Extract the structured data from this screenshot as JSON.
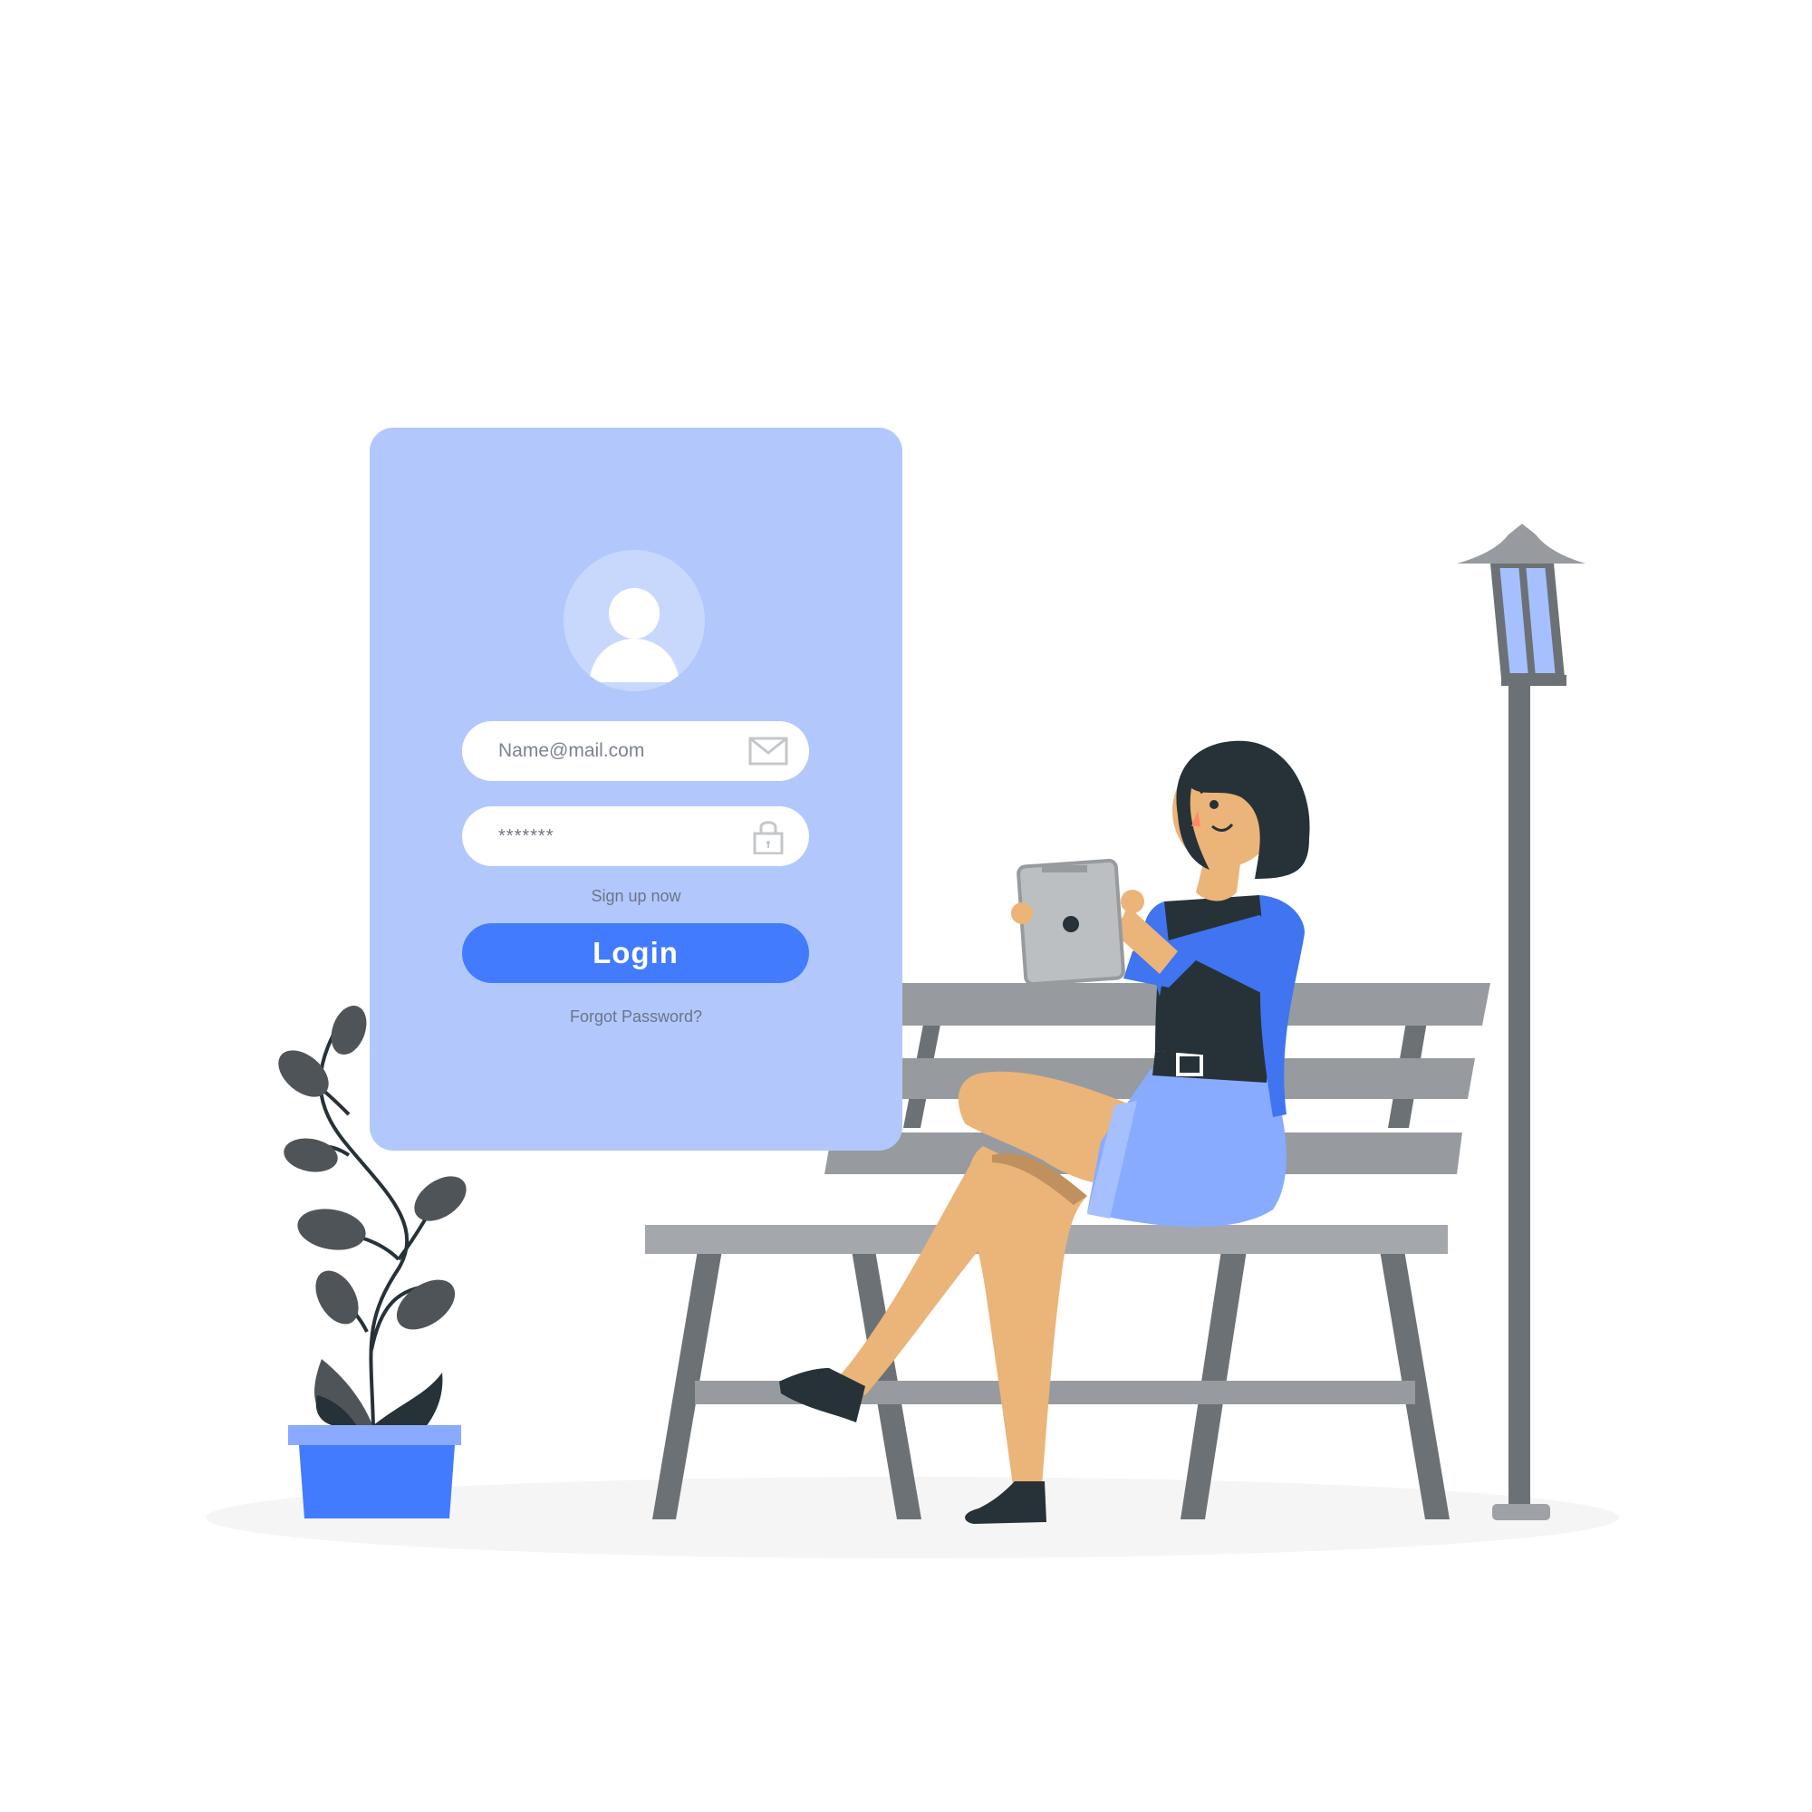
{
  "login_form": {
    "email_placeholder": "Name@mail.com",
    "password_value": "*******",
    "signup_label": "Sign up now",
    "login_label": "Login",
    "forgot_label": "Forgot Password?"
  },
  "icons": {
    "avatar": "user-icon",
    "email": "envelope-icon",
    "password": "lock-icon"
  },
  "colors": {
    "card": "#b2c8fc",
    "button": "#437bff",
    "bench": "#979b9f",
    "lamp_glass": "#a6c0ff",
    "pot": "#437bff",
    "jacket": "#4074f0",
    "skirt": "#89abff",
    "skin": "#ebb479",
    "dark": "#263238"
  }
}
